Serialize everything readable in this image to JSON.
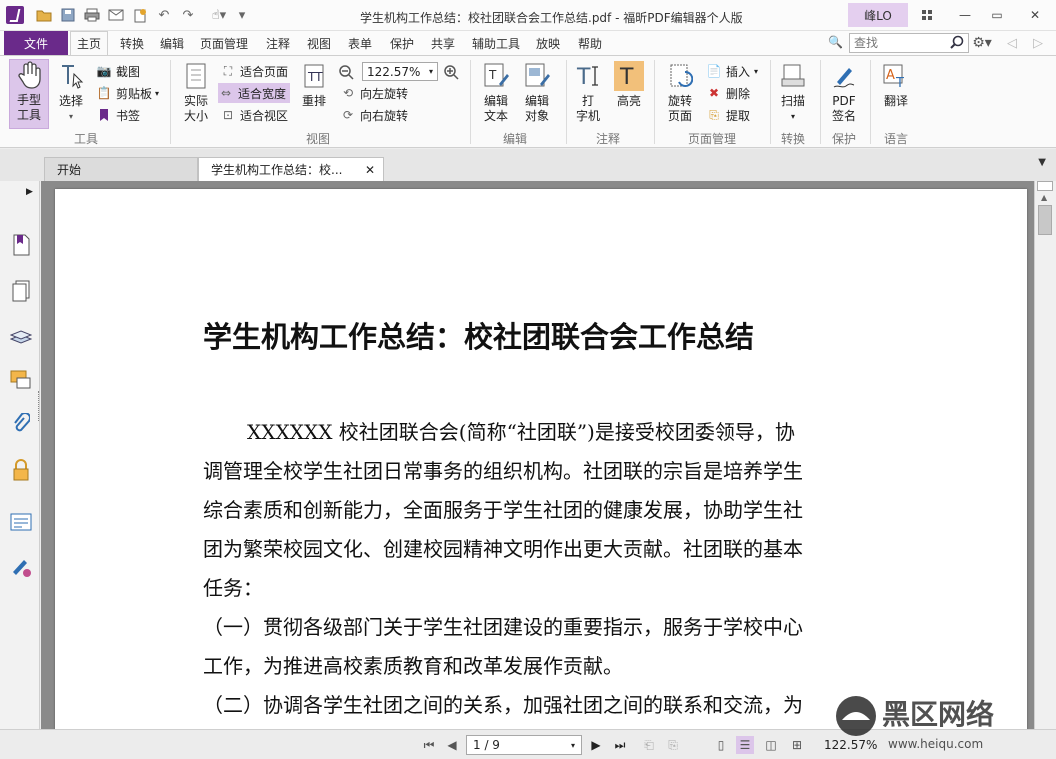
{
  "window": {
    "title": "学生机构工作总结：校社团联合会工作总结.pdf - 福昕PDF编辑器个人版",
    "user": "峰LO"
  },
  "menu": {
    "file": "文件",
    "tabs": [
      "主页",
      "转换",
      "编辑",
      "页面管理",
      "注释",
      "视图",
      "表单",
      "保护",
      "共享",
      "辅助工具",
      "放映",
      "帮助"
    ],
    "search_placeholder": "查找"
  },
  "ribbon": {
    "tools": {
      "hand": "手型\n工具",
      "select": "选择",
      "screenshot": "截图",
      "clipboard": "剪贴板",
      "bookmark": "书签",
      "label": "工具"
    },
    "view": {
      "actual_size": "实际\n大小",
      "fit_page": "适合页面",
      "fit_width": "适合宽度",
      "fit_visible": "适合视区",
      "reflow": "重排",
      "zoom": "122.57%",
      "rotate_left": "向左旋转",
      "rotate_right": "向右旋转",
      "label": "视图"
    },
    "edit": {
      "edit_text": "编辑\n文本",
      "edit_object": "编辑\n对象",
      "label": "编辑"
    },
    "comment": {
      "typewriter": "打\n字机",
      "highlight": "高亮",
      "label": "注释"
    },
    "pages": {
      "rotate_page": "旋转\n页面",
      "insert": "插入",
      "delete": "删除",
      "extract": "提取",
      "label": "页面管理"
    },
    "convert": {
      "scan": "扫描",
      "label": "转换"
    },
    "protect": {
      "sign": "PDF\n签名",
      "label": "保护"
    },
    "language": {
      "translate": "翻译",
      "label": "语言"
    }
  },
  "doc_tabs": [
    {
      "label": "开始"
    },
    {
      "label": "学生机构工作总结：校..."
    }
  ],
  "document": {
    "title": "学生机构工作总结：校社团联合会工作总结",
    "lines": [
      "XXXXXX 校社团联合会(简称“社团联”)是接受校团委领导，协",
      "调管理全校学生社团日常事务的组织机构。社团联的宗旨是培养学生",
      "综合素质和创新能力，全面服务于学生社团的健康发展，协助学生社",
      "团为繁荣校园文化、创建校园精神文明作出更大贡献。社团联的基本",
      "任务：",
      "（一）贯彻各级部门关于学生社团建设的重要指示，服务于学校中心",
      "工作，为推进高校素质教育和改革发展作贡献。",
      "（二）协调各学生社团之间的关系，加强社团之间的联系和交流，为"
    ]
  },
  "status": {
    "page": "1 / 9",
    "zoom": "122.57%"
  },
  "watermark": {
    "text": "黑区网络",
    "url": "www.heiqu.com"
  },
  "colors": {
    "brand": "#6a2a8a",
    "highlight": "#dcc6ea"
  }
}
